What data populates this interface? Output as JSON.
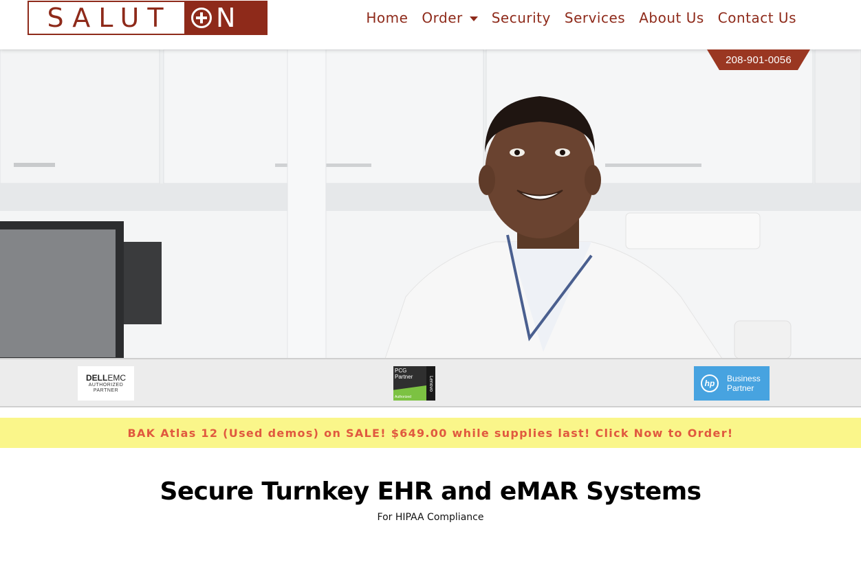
{
  "header": {
    "logo_left": "SALUT",
    "logo_right": "N",
    "nav": [
      {
        "label": "Home"
      },
      {
        "label": "Order"
      },
      {
        "label": "Security"
      },
      {
        "label": "Services"
      },
      {
        "label": "About Us"
      },
      {
        "label": "Contact Us"
      }
    ],
    "phone": "208-901-0056"
  },
  "partners": {
    "dell_brand_bold": "DELL",
    "dell_brand_light": "EMC",
    "dell_sub1": "AUTHORIZED",
    "dell_sub2": "PARTNER",
    "lenovo_line1": "PCG",
    "lenovo_line2": "Partner",
    "lenovo_side": "Lenovo",
    "lenovo_auth": "Authorized",
    "hp_mark": "hp",
    "hp_line1": "Business",
    "hp_line2": "Partner"
  },
  "promo": {
    "text": "BAK Atlas 12 (Used demos) on SALE! $649.00 while supplies last! Click Now to Order!"
  },
  "main": {
    "headline": "Secure Turnkey EHR and eMAR Systems",
    "subheadline": "For HIPAA Compliance"
  },
  "colors": {
    "brand": "#8e2a1a",
    "promo_bg": "#faf68a",
    "promo_text": "#e0593f",
    "hp_blue": "#47a3e0"
  }
}
